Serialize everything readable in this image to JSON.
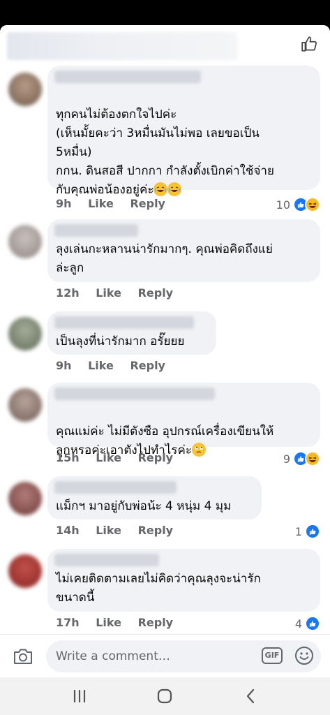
{
  "composer": {
    "placeholder": "Write a comment…",
    "gif_label": "GIF"
  },
  "comments": [
    {
      "text": "ทุกคนไม่ต้องตกใจไปค่ะ\n(เห็นมั้ยคะว่า 3หมื่นมันไม่พอ เลยขอเป็น\n5หมื่น)\nกกน. ดินสอสี ปากกา กำลังตั้งเบิกค่าใช้จ่าย\nกับคุณพ่อน้องอยู่ค่ะ",
      "emoji": [
        "rolling-laughing",
        "rolling-laughing"
      ],
      "time": "9h",
      "like": "Like",
      "reply": "Reply",
      "reaction_count": "10",
      "reactions": [
        "like",
        "haha"
      ]
    },
    {
      "text": "ลุงเล่นกะหลานน่ารักมากๆ. คุณพ่อคิดถึงแย่\nล่ะลูก",
      "time": "12h",
      "like": "Like",
      "reply": "Reply"
    },
    {
      "text": "เป็นลุงที่น่ารักมาก อรั๊ยยย",
      "time": "9h",
      "like": "Like",
      "reply": "Reply"
    },
    {
      "text": "คุณแม่ค่ะ ไม่มีตังซือ อุปกรณ์เครื่องเขียนให้\nลูกหรอค่ะเอาตังไปทำไรค่ะ",
      "emoji": [
        "rolling-eyes"
      ],
      "time": "15h",
      "like": "Like",
      "reply": "Reply",
      "reaction_count": "9",
      "reactions": [
        "like",
        "haha"
      ]
    },
    {
      "text": "แม็กฯ มาอยู่กับพ่อน้ะ 4 หนุ่ม 4 มุม",
      "time": "14h",
      "like": "Like",
      "reply": "Reply",
      "reaction_count": "1",
      "reactions": [
        "like"
      ]
    },
    {
      "text": "ไม่เคยติดตามเลยไม่คิดว่าคุณลุงจะน่ารัก\nขนาดนี้",
      "time": "17h",
      "like": "Like",
      "reply": "Reply",
      "reaction_count": "4",
      "reactions": [
        "like"
      ]
    }
  ],
  "icons": {
    "header": "thumbs-up-outline-icon",
    "composer": [
      "camera-icon",
      "gif-icon",
      "smiley-icon"
    ],
    "navbar": [
      "recent-apps-icon",
      "home-icon",
      "back-icon"
    ]
  },
  "colors": {
    "bubble": "#f0f2f5",
    "like_blue": "#1877f2",
    "haha_yellow": "#f7b928",
    "meta_gray": "#65676b"
  }
}
